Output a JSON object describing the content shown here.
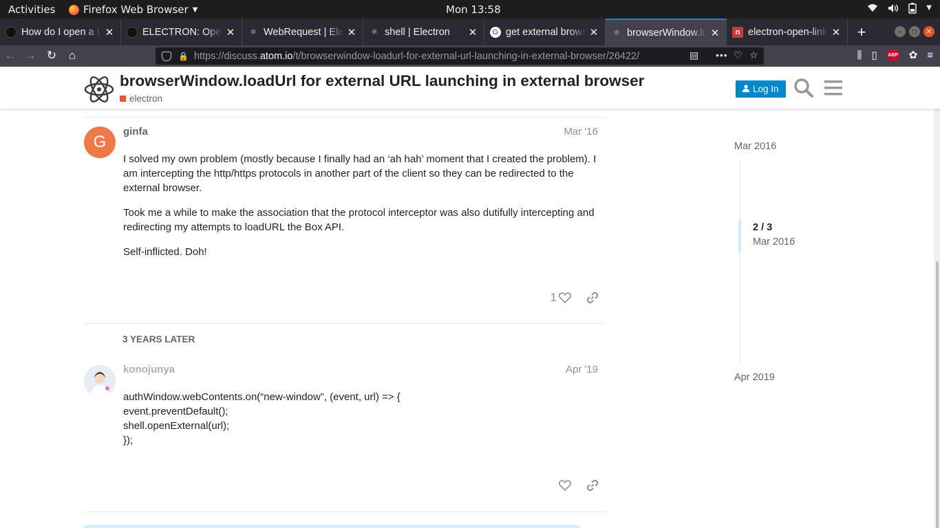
{
  "desktop": {
    "activities": "Activities",
    "app_name": "Firefox Web Browser",
    "clock": "Mon 13:58"
  },
  "tabs": [
    {
      "title": "How do I open a URL",
      "icon": "github-icon"
    },
    {
      "title": "ELECTRON: Open link",
      "icon": "github-icon"
    },
    {
      "title": "WebRequest | Electron",
      "icon": "electron-icon"
    },
    {
      "title": "shell | Electron",
      "icon": "electron-icon"
    },
    {
      "title": "get external browser",
      "icon": "google-icon"
    },
    {
      "title": "browserWindow.loadUrl",
      "icon": "atom-icon",
      "active": true
    },
    {
      "title": "electron-open-link",
      "icon": "npm-icon"
    }
  ],
  "url": {
    "prefix": "https://discuss.",
    "domain": "atom.io",
    "path": "/t/browserwindow-loadurl-for-external-url-launching-in-external-browser/26422/"
  },
  "header": {
    "title": "browserWindow.loadUrl for external URL launching in external browser",
    "category": "electron",
    "category_color": "#e45735",
    "login_label": "Log In"
  },
  "posts": [
    {
      "avatar_letter": "G",
      "avatar_color": "#f0794a",
      "username": "ginfa",
      "date": "Mar '16",
      "paragraphs": [
        "I solved my own problem (mostly because I finally had an ‘ah hah’ moment that I created the problem). I am intercepting the http/https protocols in another part of the client so they can be redirected to the external browser.",
        "Took me a while to make the association that the protocol interceptor was also dutifully intercepting and redirecting my attempts to loadURL the Box API.",
        "Self-inflicted. Doh!"
      ],
      "likes": "1"
    },
    {
      "username": "konojunya",
      "date": "Apr '19",
      "code_lines": [
        "authWindow.webContents.on(“new-window”, (event, url) => {",
        "event.preventDefault();",
        "shell.openExternal(url);",
        "});"
      ]
    }
  ],
  "gap_label": "3 YEARS LATER",
  "timeline": {
    "top_date": "Mar 2016",
    "position": "2 / 3",
    "position_date": "Mar 2016",
    "bottom_date": "Apr 2019"
  }
}
